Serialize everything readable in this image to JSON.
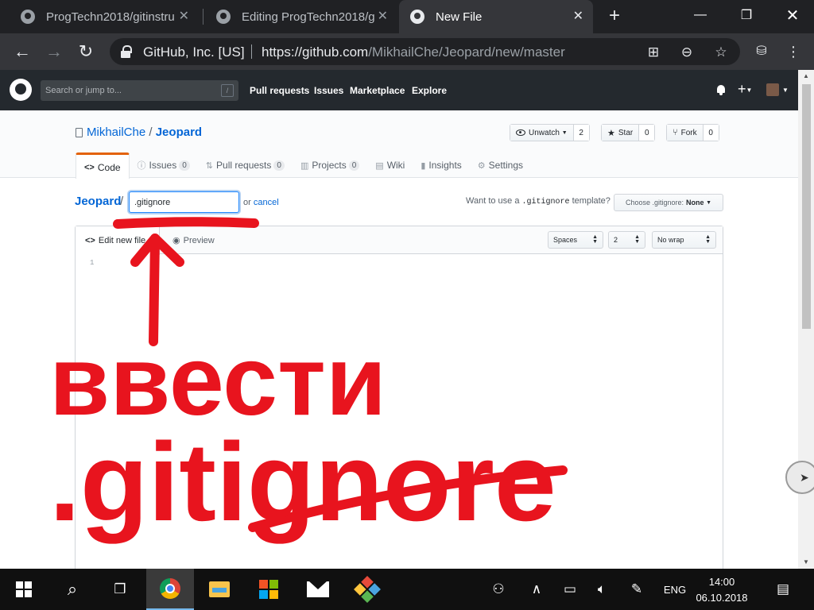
{
  "browser": {
    "tabs": [
      {
        "title": "ProgTechn2018/gitinstru"
      },
      {
        "title": "Editing ProgTechn2018/g"
      },
      {
        "title": "New File"
      }
    ],
    "site_identity": "GitHub, Inc. [US]",
    "url_host": "https://github.com",
    "url_path": "/MikhailChe/Jeopard/new/master"
  },
  "github": {
    "search_placeholder": "Search or jump to...",
    "search_key": "/",
    "nav": [
      "Pull requests",
      "Issues",
      "Marketplace",
      "Explore"
    ]
  },
  "repo": {
    "owner": "MikhailChe",
    "separator": "/",
    "name": "Jeopard",
    "watch_label": "Unwatch",
    "watch_count": "2",
    "star_label": "Star",
    "star_count": "0",
    "fork_label": "Fork",
    "fork_count": "0",
    "tabs": [
      {
        "label": "Code",
        "icon": "code-icon"
      },
      {
        "label": "Issues",
        "count": "0",
        "icon": "issue-icon"
      },
      {
        "label": "Pull requests",
        "count": "0",
        "icon": "pull-request-icon"
      },
      {
        "label": "Projects",
        "count": "0",
        "icon": "project-icon"
      },
      {
        "label": "Wiki",
        "icon": "book-icon"
      },
      {
        "label": "Insights",
        "icon": "graph-icon"
      },
      {
        "label": "Settings",
        "icon": "gear-icon"
      }
    ]
  },
  "editor": {
    "breadcrumb_repo": "Jeopard",
    "breadcrumb_slash": "/",
    "filename_value": ".gitignore",
    "or_text": "or",
    "cancel_label": "cancel",
    "template_prefix": "Want to use a",
    "template_code": ".gitignore",
    "template_suffix": "template?",
    "template_button_label": "Choose .gitignore:",
    "template_button_value": "None",
    "tab_edit": "Edit new file",
    "tab_preview": "Preview",
    "indent_mode": "Spaces",
    "indent_size": "2",
    "wrap_mode": "No wrap",
    "line_number": "1"
  },
  "annotation": {
    "word1": "ввести",
    "word2": ".gitignore",
    "color": "#e8141e"
  },
  "taskbar": {
    "language": "ENG",
    "time": "14:00",
    "date": "06.10.2018"
  },
  "colors": {
    "chrome_dark": "#202124",
    "chrome_toolbar": "#35363a",
    "github_header": "#24292e",
    "link_blue": "#0366d6",
    "tab_accent": "#e36209"
  }
}
